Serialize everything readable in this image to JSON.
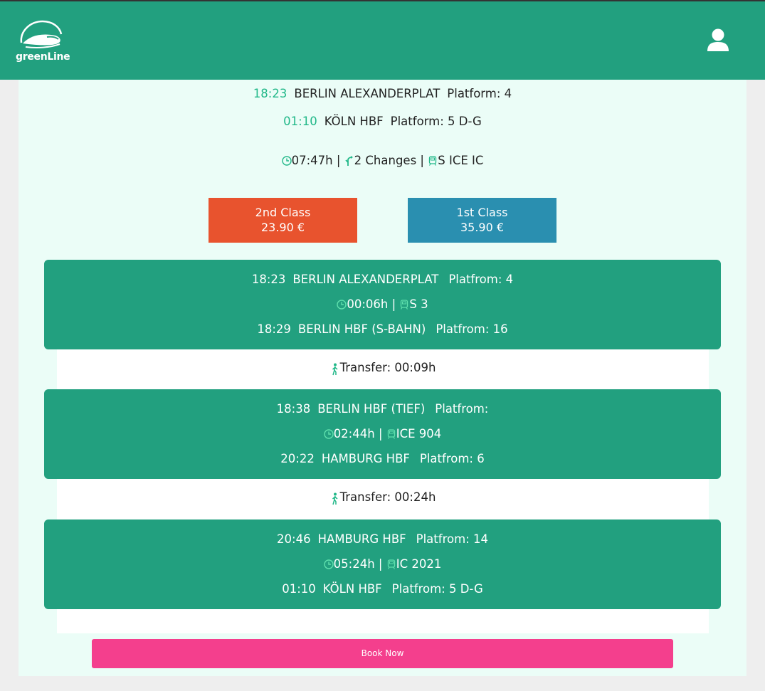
{
  "app": {
    "logo_text": "greenLine",
    "brand_color": "#22a07f",
    "profile_icon": "user-icon"
  },
  "summary": {
    "departure": {
      "time": "18:23",
      "station": "BERLIN ALEXANDERPLAT",
      "platform": "Platform: 4"
    },
    "arrival": {
      "time": "01:10",
      "station": "KÖLN HBF",
      "platform": "Platform: 5 D-G"
    },
    "duration": "07:47h |",
    "changes": "2 Changes |",
    "train_types": "S  ICE  IC"
  },
  "prices": {
    "second": {
      "label": "2nd Class",
      "price": "23.90 €",
      "color": "#e8532e"
    },
    "first": {
      "label": "1st Class",
      "price": "35.90 €",
      "color": "#2a8fb0"
    }
  },
  "legs": [
    {
      "dep_time": "18:23",
      "dep_station": "BERLIN ALEXANDERPLAT",
      "dep_platform": "Platfrom: 4",
      "duration": "00:06h |",
      "train": "S 3",
      "arr_time": "18:29",
      "arr_station": "BERLIN HBF (S-BAHN)",
      "arr_platform": "Platfrom: 16"
    },
    {
      "dep_time": "18:38",
      "dep_station": "BERLIN HBF (TIEF)",
      "dep_platform": "Platfrom:",
      "duration": "02:44h |",
      "train": "ICE 904",
      "arr_time": "20:22",
      "arr_station": "HAMBURG HBF",
      "arr_platform": "Platfrom: 6"
    },
    {
      "dep_time": "20:46",
      "dep_station": "HAMBURG HBF",
      "dep_platform": "Platfrom: 14",
      "duration": "05:24h |",
      "train": "IC 2021",
      "arr_time": "01:10",
      "arr_station": "KÖLN HBF",
      "arr_platform": "Platfrom: 5 D-G"
    }
  ],
  "transfers": [
    {
      "text": "Transfer: 00:09h",
      "icon": "walking-icon"
    },
    {
      "text": "Transfer: 00:24h",
      "icon": "walking-icon"
    }
  ],
  "book_button": {
    "label": "Book Now",
    "color": "#f43f8d"
  }
}
